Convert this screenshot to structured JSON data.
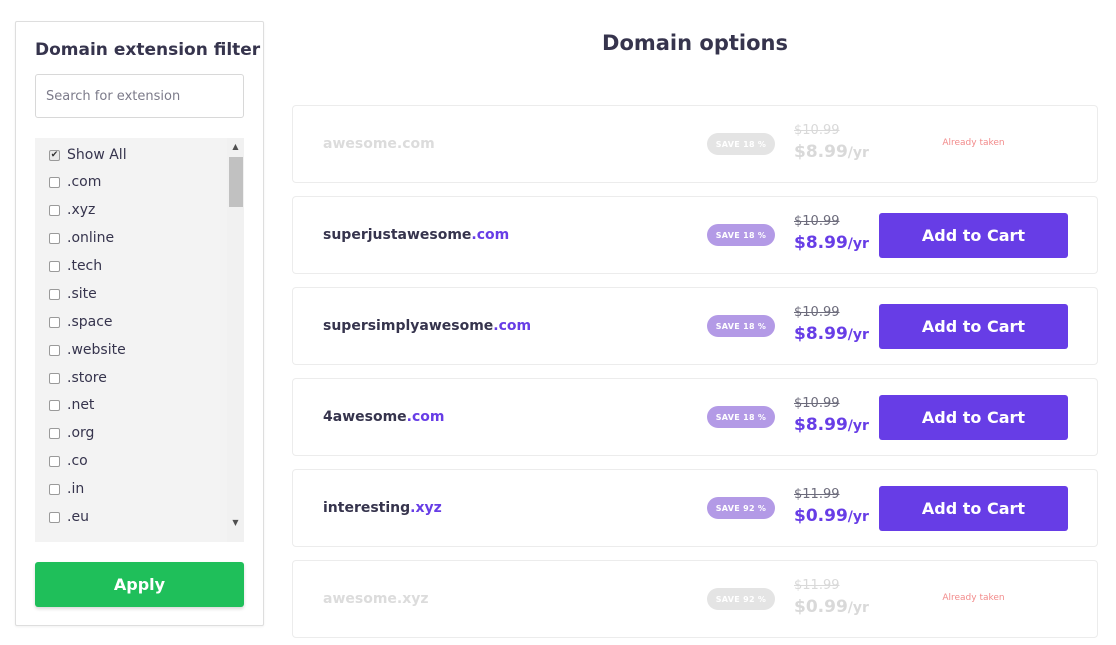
{
  "filter": {
    "title": "Domain extension filter",
    "search_placeholder": "Search for extension",
    "search_value": "",
    "extensions": [
      {
        "label": "Show All",
        "checked": true
      },
      {
        "label": ".com",
        "checked": false
      },
      {
        "label": ".xyz",
        "checked": false
      },
      {
        "label": ".online",
        "checked": false
      },
      {
        "label": ".tech",
        "checked": false
      },
      {
        "label": ".site",
        "checked": false
      },
      {
        "label": ".space",
        "checked": false
      },
      {
        "label": ".website",
        "checked": false
      },
      {
        "label": ".store",
        "checked": false
      },
      {
        "label": ".net",
        "checked": false
      },
      {
        "label": ".org",
        "checked": false
      },
      {
        "label": ".co",
        "checked": false
      },
      {
        "label": ".in",
        "checked": false
      },
      {
        "label": ".eu",
        "checked": false
      }
    ],
    "apply_label": "Apply",
    "scroll_up_icon": "▲",
    "scroll_down_icon": "▼"
  },
  "main": {
    "title": "Domain options",
    "domains": [
      {
        "name": "awesome",
        "tld": ".com",
        "save": "SAVE 18 %",
        "old_price": "$10.99",
        "new_price": "$8.99",
        "per": "/yr",
        "taken": true,
        "taken_label": "Already taken"
      },
      {
        "name": "superjustawesome",
        "tld": ".com",
        "save": "SAVE 18 %",
        "old_price": "$10.99",
        "new_price": "$8.99",
        "per": "/yr",
        "taken": false,
        "action_label": "Add to Cart"
      },
      {
        "name": "supersimplyawesome",
        "tld": ".com",
        "save": "SAVE 18 %",
        "old_price": "$10.99",
        "new_price": "$8.99",
        "per": "/yr",
        "taken": false,
        "action_label": "Add to Cart"
      },
      {
        "name": "4awesome",
        "tld": ".com",
        "save": "SAVE 18 %",
        "old_price": "$10.99",
        "new_price": "$8.99",
        "per": "/yr",
        "taken": false,
        "action_label": "Add to Cart"
      },
      {
        "name": "interesting",
        "tld": ".xyz",
        "save": "SAVE 92 %",
        "old_price": "$11.99",
        "new_price": "$0.99",
        "per": "/yr",
        "taken": false,
        "action_label": "Add to Cart"
      },
      {
        "name": "awesome",
        "tld": ".xyz",
        "save": "SAVE 92 %",
        "old_price": "$11.99",
        "new_price": "$0.99",
        "per": "/yr",
        "taken": true,
        "taken_label": "Already taken"
      }
    ]
  },
  "colors": {
    "accent": "#673de6",
    "apply": "#1fbf5a",
    "badge": "#b39ae6",
    "taken_text": "#f28b8b"
  }
}
